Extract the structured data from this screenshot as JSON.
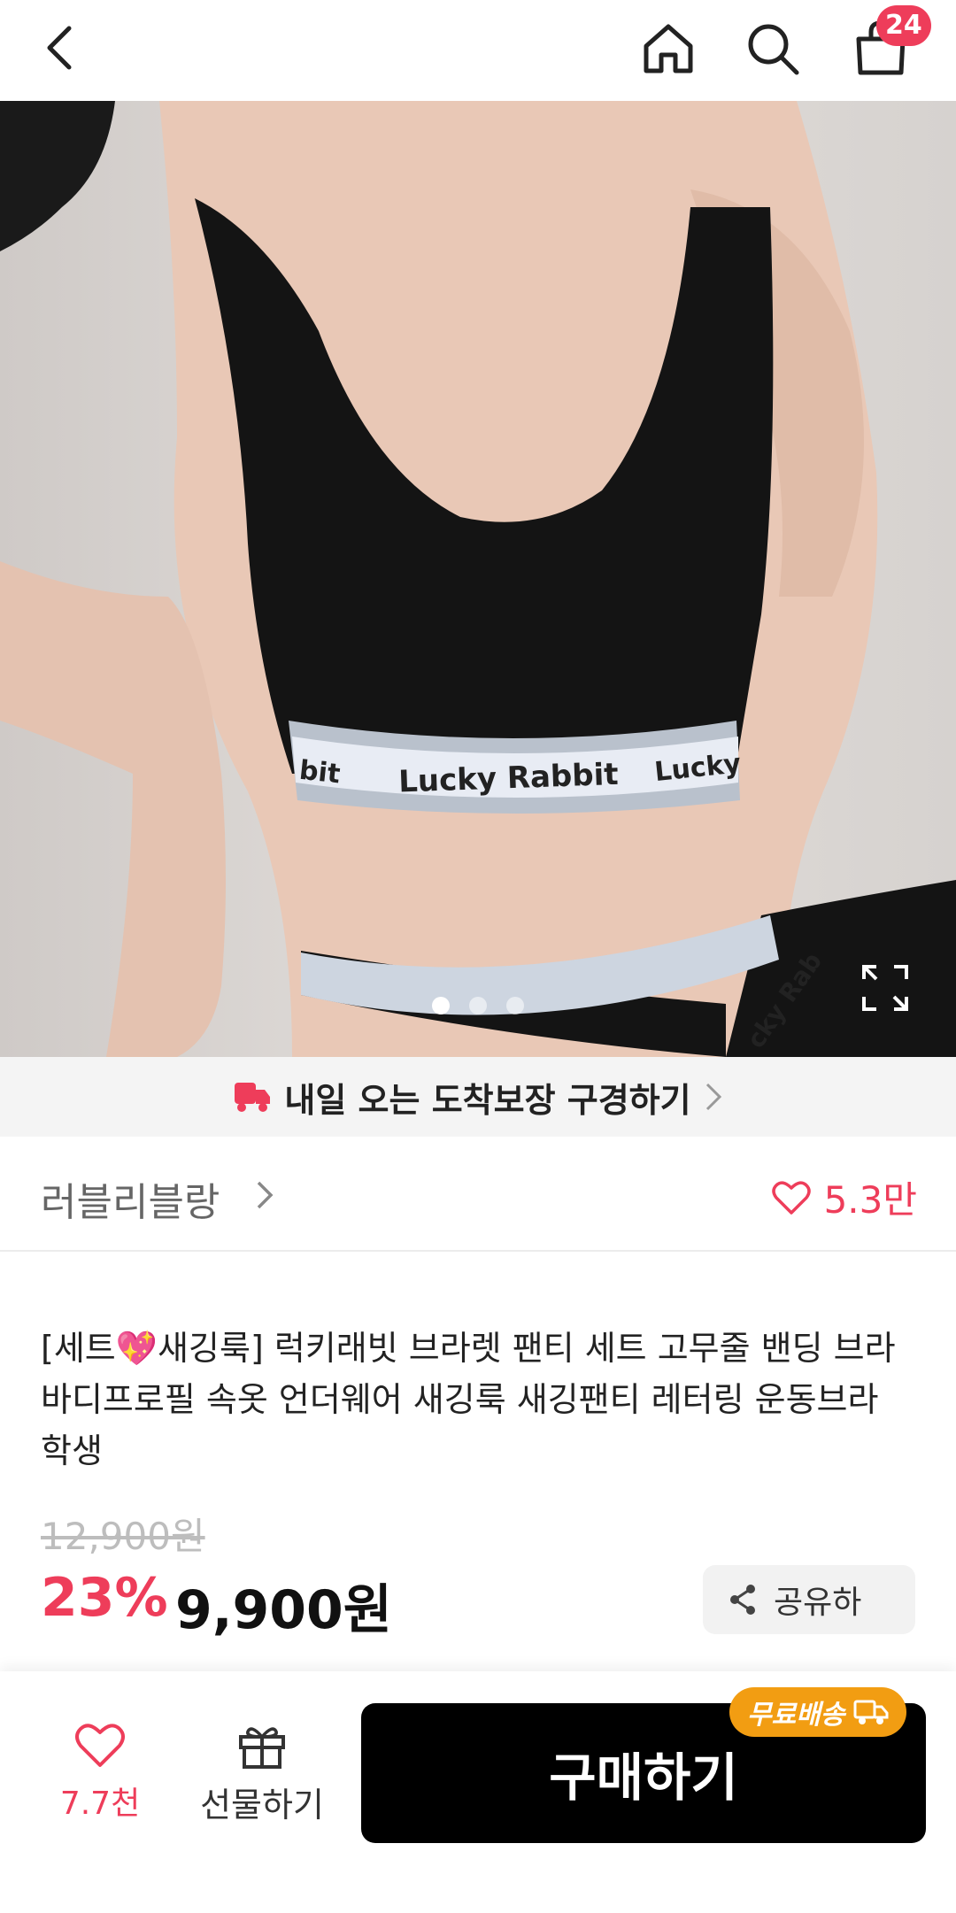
{
  "header": {
    "cart_count": "24"
  },
  "gallery": {
    "band_text_main": "Lucky Rabbit",
    "band_text_left": "bit",
    "band_text_right": "Lucky",
    "band_text_lower": "cky Rab",
    "page_count": 3,
    "active_page": 1
  },
  "delivery": {
    "label": "내일 오는 도착보장 구경하기"
  },
  "brand": {
    "name": "러블리블랑",
    "likes": "5.3만"
  },
  "product": {
    "title": "[세트💖새깅룩] 럭키래빗 브라렛 팬티 세트 고무줄 밴딩 브라 바디프로필 속옷 언더웨어 새깅룩 새깅팬티 레터링 운동브라 학생",
    "original_price": "12,900원",
    "discount": "23%",
    "price": "9,900원",
    "share_label": "공유하"
  },
  "bottom_bar": {
    "wish_count": "7.7천",
    "gift_label": "선물하기",
    "buy_label": "구매하기",
    "free_shipping_label": "무료배송"
  },
  "colors": {
    "accent": "#ee3d5a",
    "free_shipping": "#f29d12",
    "buy_button": "#000000"
  }
}
